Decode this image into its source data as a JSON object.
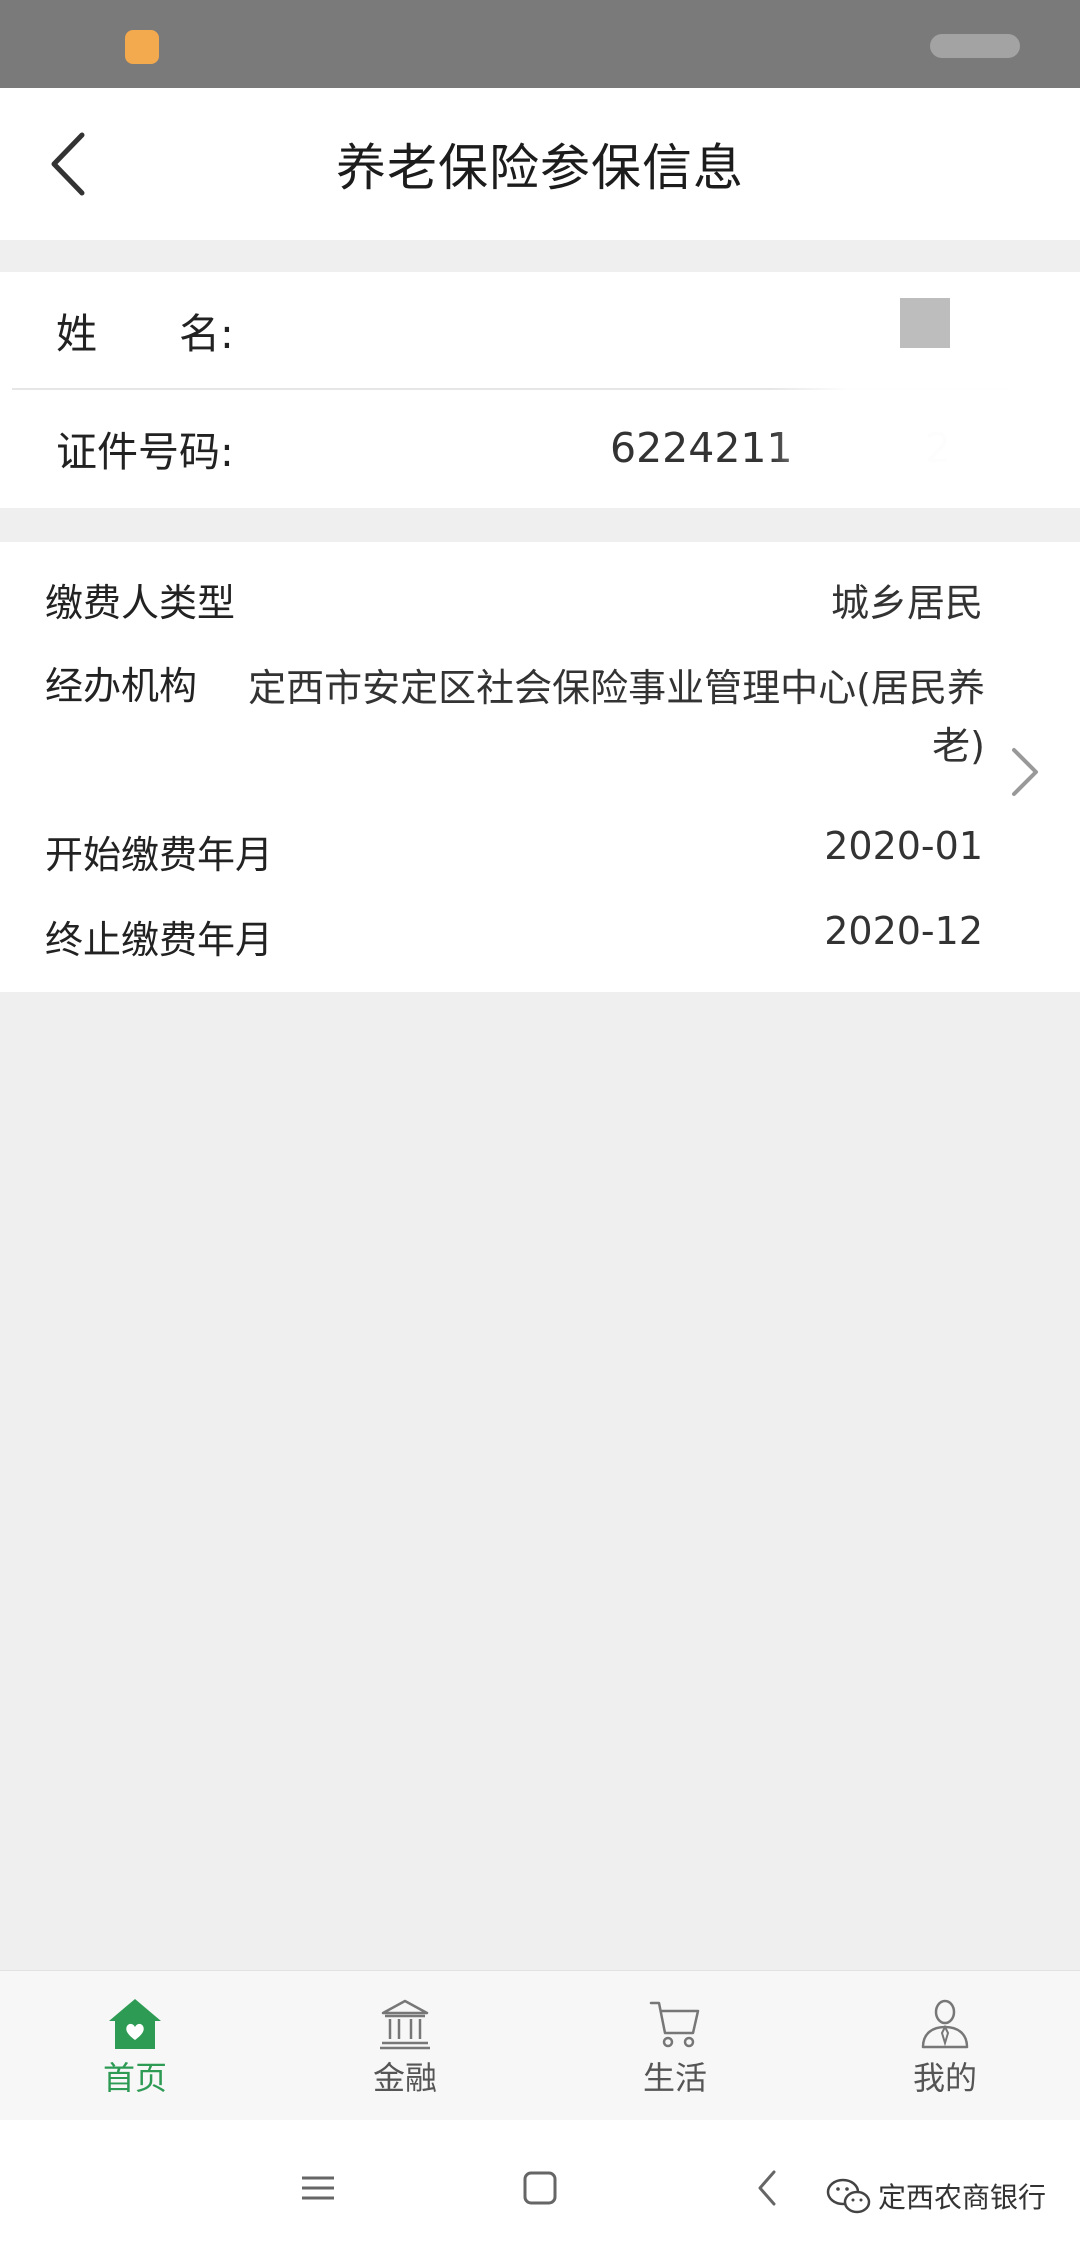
{
  "header": {
    "title": "养老保险参保信息"
  },
  "identity": {
    "name_label": "姓　　名:",
    "name_value": "",
    "id_label": "证件号码:",
    "id_value": "6224211",
    "id_tail": "2"
  },
  "details": {
    "payer_type_label": "缴费人类型",
    "payer_type_value": "城乡居民",
    "org_label": "经办机构",
    "org_value": "定西市安定区社会保险事业管理中心(居民养老)",
    "start_label": "开始缴费年月",
    "start_value": "2020-01",
    "end_label": "终止缴费年月",
    "end_value": "2020-12"
  },
  "tabs": [
    {
      "label": "首页",
      "icon": "home-icon",
      "active": true
    },
    {
      "label": "金融",
      "icon": "bank-icon",
      "active": false
    },
    {
      "label": "生活",
      "icon": "cart-icon",
      "active": false
    },
    {
      "label": "我的",
      "icon": "user-icon",
      "active": false
    }
  ],
  "colors": {
    "accent": "#2e9b55",
    "background": "#efefef",
    "statusbar": "#7a7a7a"
  },
  "watermark": {
    "text": "定西农商银行"
  }
}
